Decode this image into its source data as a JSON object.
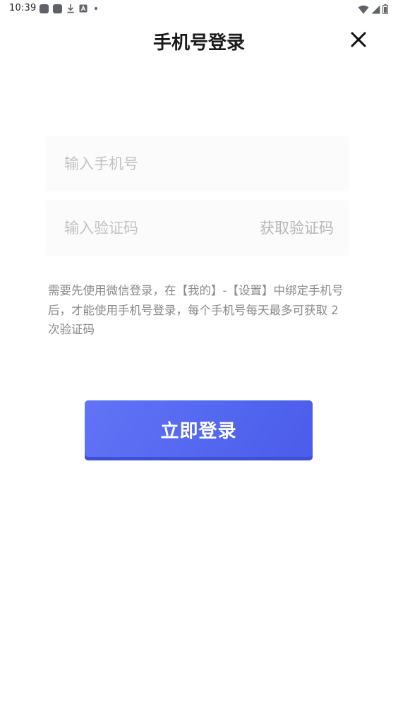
{
  "status_bar": {
    "time": "10:39",
    "icons": [
      "app-icon",
      "app-icon",
      "download-icon",
      "a-icon",
      "dot-icon",
      "wifi-icon",
      "signal-icon",
      "battery-icon"
    ]
  },
  "header": {
    "title": "手机号登录",
    "close_icon": "close-icon"
  },
  "form": {
    "phone_placeholder": "输入手机号",
    "code_placeholder": "输入验证码",
    "get_code_label": "获取验证码"
  },
  "hint": {
    "text": "需要先使用微信登录，在【我的】-【设置】中绑定手机号后，才能使用手机号登录，每个手机号每天最多可获取 2 次验证码"
  },
  "login_button": {
    "label": "立即登录"
  },
  "colors": {
    "accent": "#5467f0",
    "hint_text": "#8a8a8a",
    "placeholder": "#c2c2c2",
    "field_bg": "#fbfbfc"
  }
}
